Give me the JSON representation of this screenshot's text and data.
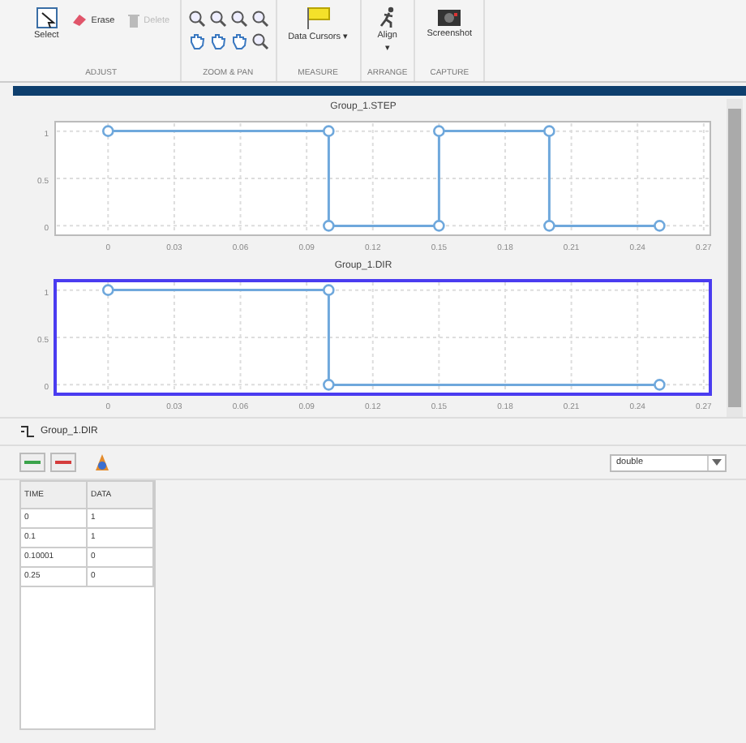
{
  "toolbar": {
    "groups": [
      {
        "label": "ADJUST",
        "items": [
          {
            "kind": "large",
            "label": "Select"
          },
          {
            "kind": "small",
            "label": "Erase",
            "disabled": false
          },
          {
            "kind": "small",
            "label": "Delete",
            "disabled": true
          }
        ]
      },
      {
        "label": "ZOOM & PAN",
        "items": [
          {
            "kind": "grid"
          }
        ]
      },
      {
        "label": "MEASURE",
        "items": [
          {
            "kind": "large",
            "label": "Data Cursors ▾"
          }
        ]
      },
      {
        "label": "ARRANGE",
        "items": [
          {
            "kind": "large",
            "label": "Align",
            "caret": "▾"
          }
        ]
      },
      {
        "label": "CAPTURE",
        "items": [
          {
            "kind": "large",
            "label": "Screenshot"
          }
        ]
      }
    ]
  },
  "plots": [
    {
      "title": "Group_1.STEP",
      "selected": false,
      "chart_data": {
        "type": "line",
        "x": [
          0,
          0.1,
          0.1,
          0.15,
          0.15,
          0.2,
          0.2,
          0.25
        ],
        "grid": true,
        "series": [
          {
            "color": "#6fa8dc",
            "marker": "o",
            "values": [
              1,
              1,
              0,
              0,
              1,
              1,
              0,
              0
            ]
          }
        ],
        "xlim": [
          -0.024,
          0.273
        ],
        "ylim": [
          -0.1,
          1.1
        ],
        "xticks": [
          0,
          0.03,
          0.06,
          0.09,
          0.12,
          0.15,
          0.18,
          0.21,
          0.24,
          0.27
        ],
        "yticks": [
          0,
          0.5,
          1
        ]
      }
    },
    {
      "title": "Group_1.DIR",
      "selected": true,
      "chart_data": {
        "type": "line",
        "x": [
          0,
          0.1,
          0.1,
          0.25
        ],
        "grid": true,
        "series": [
          {
            "color": "#6fa8dc",
            "marker": "o",
            "values": [
              1,
              1,
              0,
              0
            ]
          }
        ],
        "xlim": [
          -0.024,
          0.273
        ],
        "ylim": [
          -0.1,
          1.1
        ],
        "xticks": [
          0,
          0.03,
          0.06,
          0.09,
          0.12,
          0.15,
          0.18,
          0.21,
          0.24,
          0.27
        ],
        "yticks": [
          0,
          0.5,
          1
        ]
      }
    }
  ],
  "signal_label": "Group_1.DIR",
  "type_select": {
    "value": "double"
  },
  "table": {
    "columns": [
      "TIME",
      "DATA"
    ],
    "rows": [
      [
        "0",
        "1"
      ],
      [
        "0.1",
        "1"
      ],
      [
        "0.10001",
        "0"
      ],
      [
        "0.25",
        "0"
      ]
    ]
  }
}
